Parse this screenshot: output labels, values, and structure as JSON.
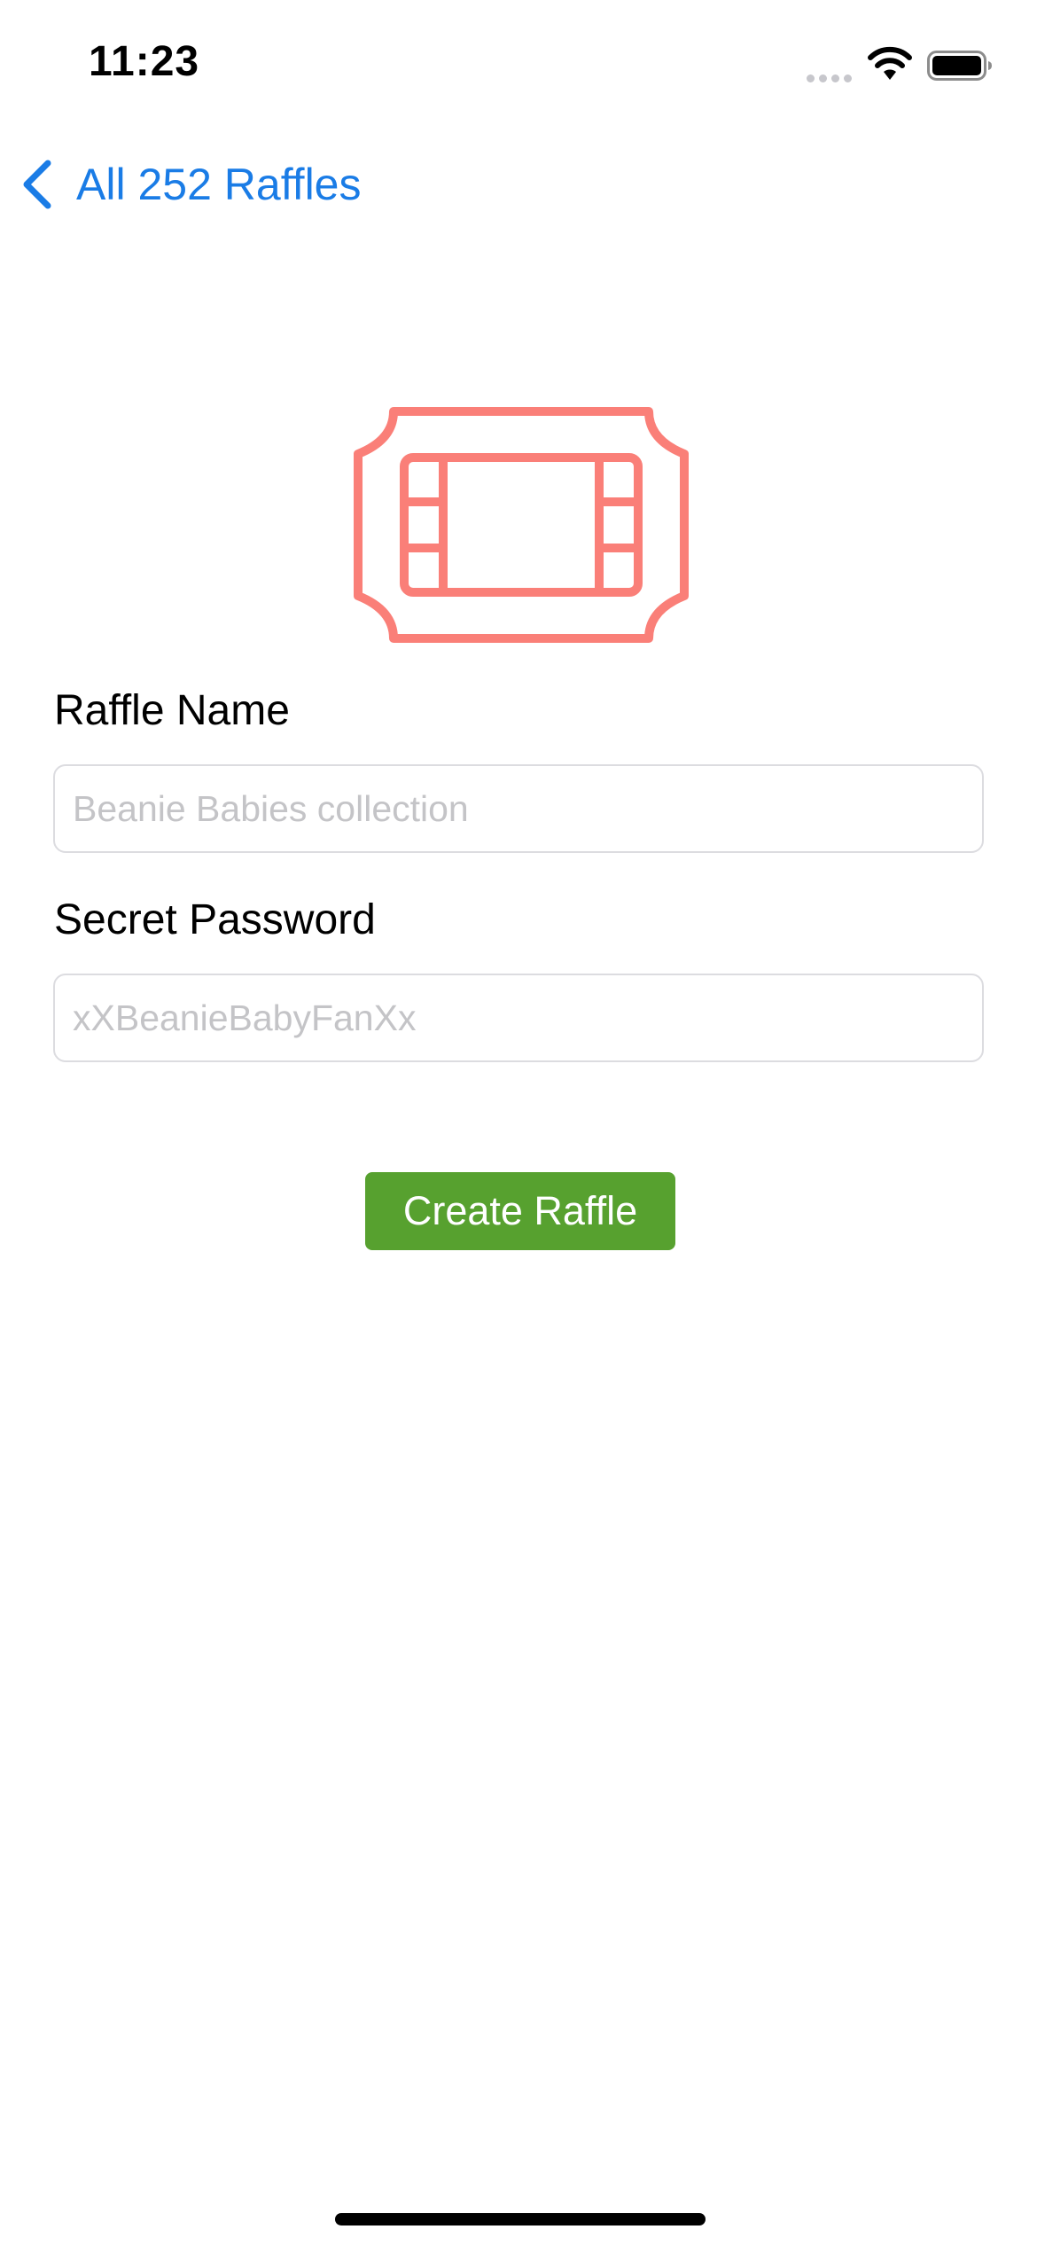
{
  "status_bar": {
    "time": "11:23",
    "signal_icon": "cellular-signal-icon",
    "wifi_icon": "wifi-icon",
    "battery_icon": "battery-full-icon"
  },
  "nav": {
    "back_icon": "chevron-left-icon",
    "back_label": "All 252 Raffles"
  },
  "hero": {
    "icon": "ticket-icon",
    "icon_color": "#fa7f78"
  },
  "form": {
    "name_label": "Raffle Name",
    "name_placeholder": "Beanie Babies collection",
    "name_value": "",
    "password_label": "Secret Password",
    "password_placeholder": "xXBeanieBabyFanXx",
    "password_value": ""
  },
  "actions": {
    "create_label": "Create Raffle",
    "create_color": "#57a12f"
  },
  "colors": {
    "link": "#1a7ce6",
    "placeholder": "#c4c4c7"
  }
}
